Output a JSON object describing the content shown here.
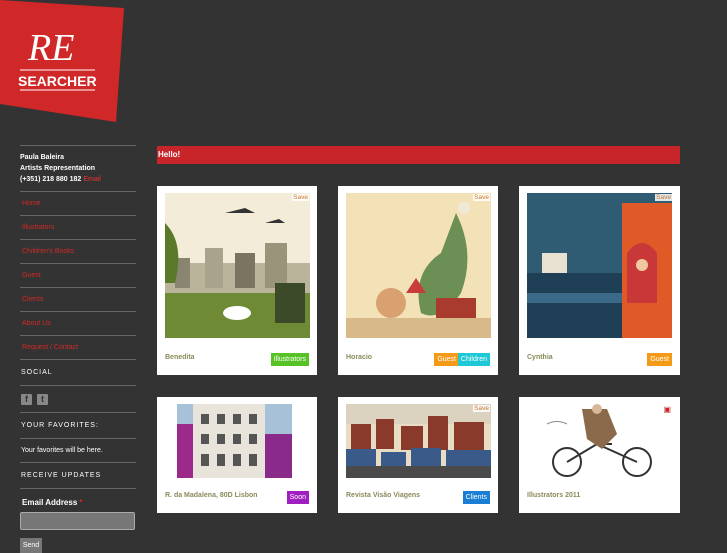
{
  "brand": {
    "logo_text": "RE",
    "logo_word": "SEARCHER",
    "color": "#d02828"
  },
  "contact": {
    "name": "Paula Baleira",
    "role": "Artists Representation",
    "phone": "(+351) 218 880 182",
    "email_label": "Email"
  },
  "nav": [
    {
      "label": "Home"
    },
    {
      "label": "Illustrators"
    },
    {
      "label": "Children's Books"
    },
    {
      "label": "Guest"
    },
    {
      "label": "Clients"
    },
    {
      "label": "About Us"
    },
    {
      "label": "Request / Contact"
    }
  ],
  "social": {
    "heading": "SOCIAL",
    "icons": [
      "facebook-icon",
      "twitter-icon"
    ],
    "fb": "f",
    "tw": "t"
  },
  "favorites": {
    "heading": "YOUR FAVORITES:",
    "text": "Your favorites will be here."
  },
  "updates": {
    "heading": "RECEIVE UPDATES",
    "email_label": "Email Address",
    "required_mark": "*",
    "send_label": "Send"
  },
  "main": {
    "greeting": "Hello!"
  },
  "cards": [
    {
      "title": "Benedita",
      "save": "Save",
      "tags": [
        {
          "label": "Illustrators",
          "color": "#56c226"
        }
      ]
    },
    {
      "title": "Horacio",
      "save": "Save",
      "tags": [
        {
          "label": "Guest",
          "color": "#f49a16"
        },
        {
          "label": "Children",
          "color": "#1ec8d6"
        }
      ]
    },
    {
      "title": "Cynthia",
      "save": "Save",
      "tags": [
        {
          "label": "Guest",
          "color": "#f49a16"
        }
      ]
    },
    {
      "title": "R. da Madalena, 80D Lisbon",
      "save": "",
      "tags": [
        {
          "label": "Soon",
          "color": "#a01fc0"
        }
      ]
    },
    {
      "title": "Revista Visão Viagens",
      "save": "Save",
      "tags": [
        {
          "label": "Clients",
          "color": "#1a7fd4"
        }
      ]
    },
    {
      "title": "Illustrators 2011",
      "save": "",
      "pdf_icon": "pdf-icon",
      "tags": []
    }
  ]
}
